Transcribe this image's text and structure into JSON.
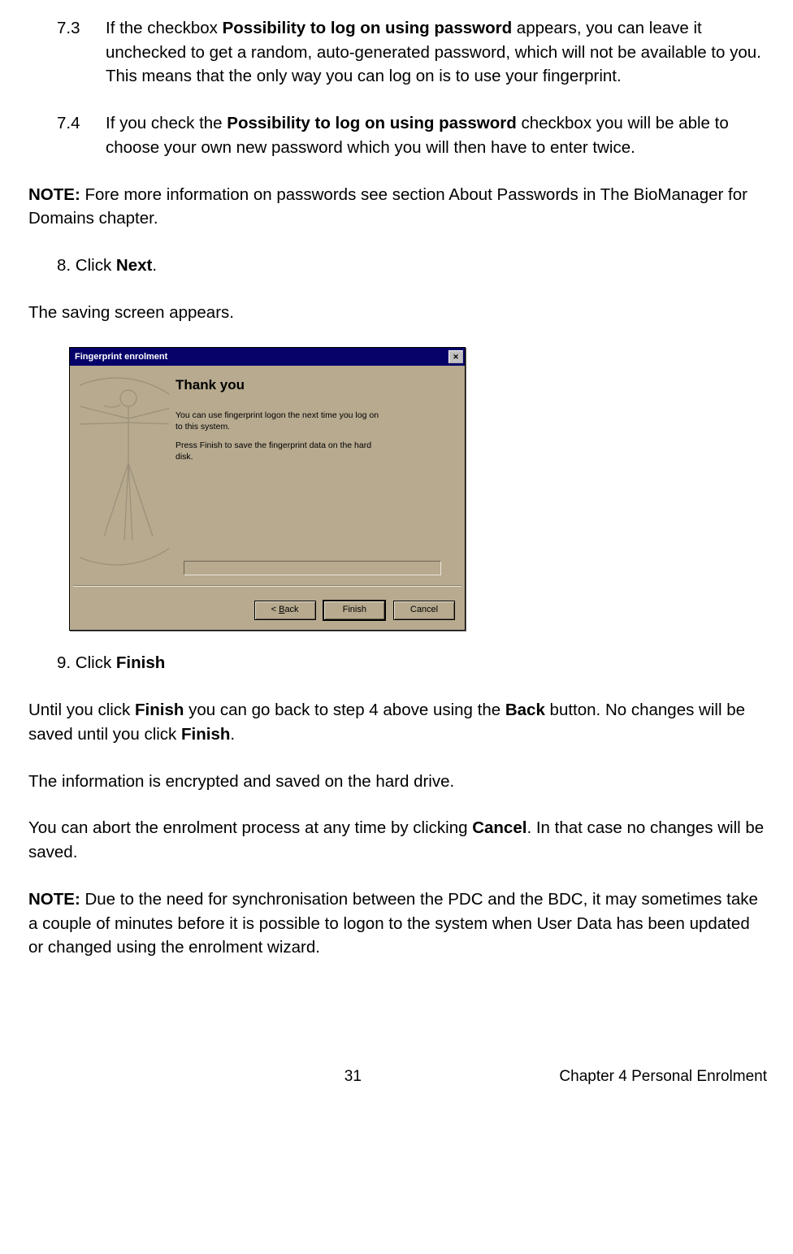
{
  "items": {
    "s73": {
      "num": "7.3",
      "text_before": "If the checkbox ",
      "bold": "Possibility to log on using password",
      "text_after": " appears, you can leave it unchecked to get a random, auto-generated password, which will not be available to you. This means that the only way you can log on is to use your fingerprint."
    },
    "s74": {
      "num": "7.4",
      "text_before": "If you check the ",
      "bold": "Possibility to log on using password",
      "text_after": " checkbox you will be able to choose your own new password which you will then have to enter twice."
    }
  },
  "note1": {
    "label": "NOTE:",
    "text": " Fore more information on passwords see section About Passwords in The BioManager for Domains chapter."
  },
  "step8": {
    "prefix": "8. Click ",
    "bold": "Next",
    "suffix": "."
  },
  "saving_line": "The saving screen appears.",
  "dialog": {
    "title": "Fingerprint enrolment",
    "heading": "Thank you",
    "line1": "You can use fingerprint logon the next time you log on to this system.",
    "line2": "Press Finish to save the fingerprint data on the hard disk.",
    "back_u": "B",
    "back_rest": "ack",
    "back_prefix": "< ",
    "finish": "Finish",
    "cancel": "Cancel"
  },
  "step9": {
    "prefix": "9. Click ",
    "bold": "Finish"
  },
  "para_finish": {
    "p1a": "Until you click ",
    "p1b": "Finish",
    "p1c": " you can go back to step 4 above using the ",
    "p1d": "Back",
    "p1e": " button. No changes will be saved until you click ",
    "p1f": "Finish",
    "p1g": "."
  },
  "para_encrypted": "The information is encrypted and saved on the hard drive.",
  "para_cancel": {
    "a": "You can abort the enrolment process at any time by clicking ",
    "b": "Cancel",
    "c": ". In that case no changes will be saved."
  },
  "note2": {
    "label": "NOTE:",
    "text": " Due to the need for synchronisation between the PDC and the BDC, it may sometimes take a couple of minutes before it is possible to logon to the system when User Data has been updated or changed using the enrolment wizard."
  },
  "footer": {
    "page": "31",
    "chapter": "Chapter 4 Personal Enrolment"
  }
}
